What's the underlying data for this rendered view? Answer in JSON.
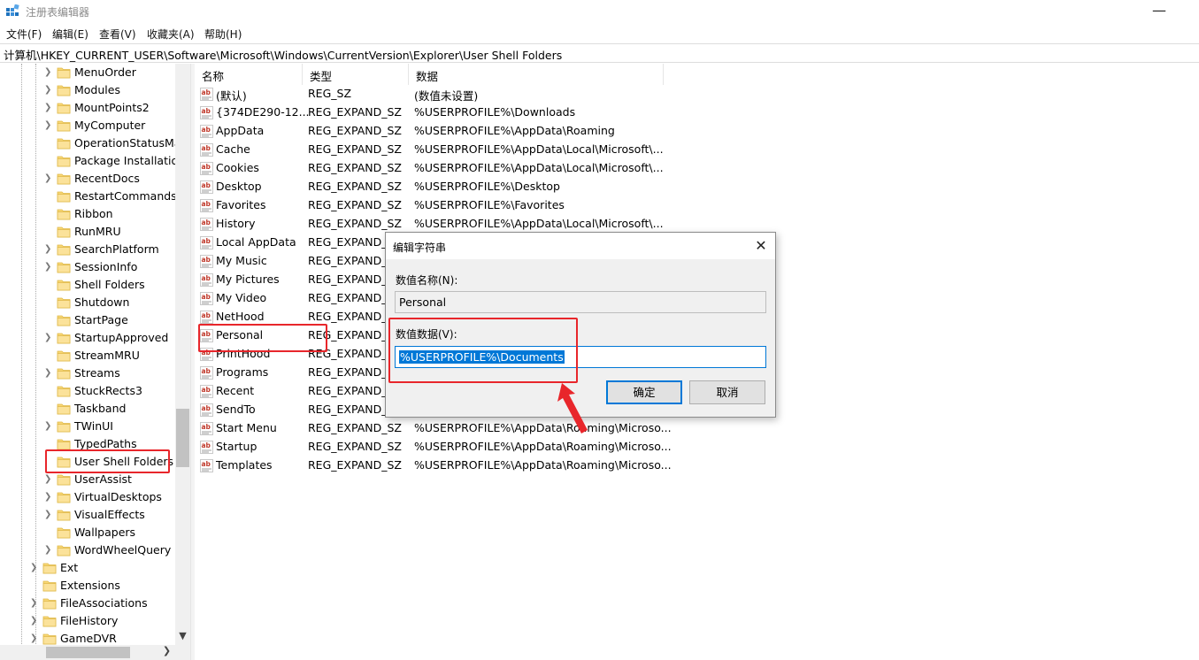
{
  "window": {
    "title": "注册表编辑器",
    "minimize_glyph": "—"
  },
  "menu": [
    "文件(F)",
    "编辑(E)",
    "查看(V)",
    "收藏夹(A)",
    "帮助(H)"
  ],
  "address": "计算机\\HKEY_CURRENT_USER\\Software\\Microsoft\\Windows\\CurrentVersion\\Explorer\\User Shell Folders",
  "tree": {
    "items": [
      {
        "label": "MenuOrder",
        "expandable": true
      },
      {
        "label": "Modules",
        "expandable": true
      },
      {
        "label": "MountPoints2",
        "expandable": true
      },
      {
        "label": "MyComputer",
        "expandable": true
      },
      {
        "label": "OperationStatusMa",
        "expandable": false
      },
      {
        "label": "Package Installatior",
        "expandable": false
      },
      {
        "label": "RecentDocs",
        "expandable": true
      },
      {
        "label": "RestartCommands",
        "expandable": false
      },
      {
        "label": "Ribbon",
        "expandable": false
      },
      {
        "label": "RunMRU",
        "expandable": false
      },
      {
        "label": "SearchPlatform",
        "expandable": true
      },
      {
        "label": "SessionInfo",
        "expandable": true
      },
      {
        "label": "Shell Folders",
        "expandable": false
      },
      {
        "label": "Shutdown",
        "expandable": false
      },
      {
        "label": "StartPage",
        "expandable": false
      },
      {
        "label": "StartupApproved",
        "expandable": true
      },
      {
        "label": "StreamMRU",
        "expandable": false
      },
      {
        "label": "Streams",
        "expandable": true
      },
      {
        "label": "StuckRects3",
        "expandable": false
      },
      {
        "label": "Taskband",
        "expandable": false
      },
      {
        "label": "TWinUI",
        "expandable": true
      },
      {
        "label": "TypedPaths",
        "expandable": false
      },
      {
        "label": "User Shell Folders",
        "expandable": false,
        "selected": true
      },
      {
        "label": "UserAssist",
        "expandable": true
      },
      {
        "label": "VirtualDesktops",
        "expandable": true
      },
      {
        "label": "VisualEffects",
        "expandable": true
      },
      {
        "label": "Wallpapers",
        "expandable": false
      },
      {
        "label": "WordWheelQuery",
        "expandable": true
      }
    ],
    "parent_items": [
      {
        "label": "Ext",
        "expandable": true
      },
      {
        "label": "Extensions",
        "expandable": false
      },
      {
        "label": "FileAssociations",
        "expandable": true
      },
      {
        "label": "FileHistory",
        "expandable": true
      },
      {
        "label": "GameDVR",
        "expandable": true
      }
    ]
  },
  "list": {
    "headers": [
      "名称",
      "类型",
      "数据"
    ],
    "rows": [
      {
        "name": "(默认)",
        "type": "REG_SZ",
        "data": "(数值未设置)"
      },
      {
        "name": "{374DE290-12...",
        "type": "REG_EXPAND_SZ",
        "data": "%USERPROFILE%\\Downloads"
      },
      {
        "name": "AppData",
        "type": "REG_EXPAND_SZ",
        "data": "%USERPROFILE%\\AppData\\Roaming"
      },
      {
        "name": "Cache",
        "type": "REG_EXPAND_SZ",
        "data": "%USERPROFILE%\\AppData\\Local\\Microsoft\\..."
      },
      {
        "name": "Cookies",
        "type": "REG_EXPAND_SZ",
        "data": "%USERPROFILE%\\AppData\\Local\\Microsoft\\..."
      },
      {
        "name": "Desktop",
        "type": "REG_EXPAND_SZ",
        "data": "%USERPROFILE%\\Desktop"
      },
      {
        "name": "Favorites",
        "type": "REG_EXPAND_SZ",
        "data": "%USERPROFILE%\\Favorites"
      },
      {
        "name": "History",
        "type": "REG_EXPAND_SZ",
        "data": "%USERPROFILE%\\AppData\\Local\\Microsoft\\..."
      },
      {
        "name": "Local AppData",
        "type": "REG_EXPAND_SZ",
        "data": ""
      },
      {
        "name": "My Music",
        "type": "REG_EXPAND_S",
        "data": ""
      },
      {
        "name": "My Pictures",
        "type": "REG_EXPAND_S",
        "data": ""
      },
      {
        "name": "My Video",
        "type": "REG_EXPAND_S",
        "data": ""
      },
      {
        "name": "NetHood",
        "type": "REG_EXPAND_S",
        "data": ""
      },
      {
        "name": "Personal",
        "type": "REG_EXPAND_S",
        "data": ""
      },
      {
        "name": "PrintHood",
        "type": "REG_EXPAND_S",
        "data": ""
      },
      {
        "name": "Programs",
        "type": "REG_EXPAND_S",
        "data": ""
      },
      {
        "name": "Recent",
        "type": "REG_EXPAND_S",
        "data": ""
      },
      {
        "name": "SendTo",
        "type": "REG_EXPAND_S",
        "data": ""
      },
      {
        "name": "Start Menu",
        "type": "REG_EXPAND_SZ",
        "data": "%USERPROFILE%\\AppData\\Roaming\\Microso..."
      },
      {
        "name": "Startup",
        "type": "REG_EXPAND_SZ",
        "data": "%USERPROFILE%\\AppData\\Roaming\\Microso..."
      },
      {
        "name": "Templates",
        "type": "REG_EXPAND_SZ",
        "data": "%USERPROFILE%\\AppData\\Roaming\\Microso..."
      }
    ]
  },
  "dialog": {
    "title": "编辑字符串",
    "name_label": "数值名称(N):",
    "name_value": "Personal",
    "data_label": "数值数据(V):",
    "data_value": "%USERPROFILE%\\Documents",
    "ok_label": "确定",
    "cancel_label": "取消",
    "close_glyph": "✕"
  },
  "colors": {
    "highlight_red": "#e8262b",
    "selection_blue": "#0078d7",
    "folder_yellow": "#f8d775"
  }
}
